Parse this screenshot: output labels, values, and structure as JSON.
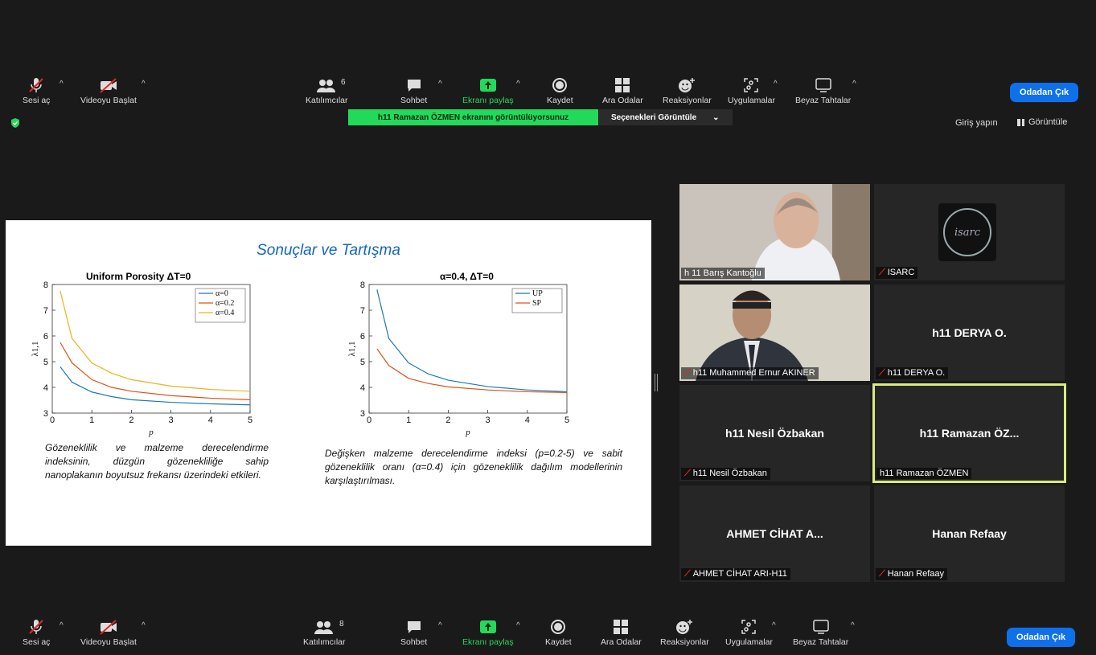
{
  "toolbar_top": {
    "mute": "Sesi aç",
    "video": "Videoyu Başlat",
    "participants": "Katılımcılar",
    "participants_count": "6",
    "chat": "Sohbet",
    "share": "Ekranı paylaş",
    "record": "Kaydet",
    "breakout": "Ara Odalar",
    "reactions": "Reaksiyonlar",
    "apps": "Uygulamalar",
    "whiteboard": "Beyaz Tahtalar",
    "leave": "Odadan Çık"
  },
  "toolbar_bottom": {
    "mute": "Sesi aç",
    "video": "Videoyu Başlat",
    "participants": "Katılımcılar",
    "participants_count": "8",
    "chat": "Sohbet",
    "share": "Ekranı paylaş",
    "record": "Kaydet",
    "breakout": "Ara Odalar",
    "reactions": "Reaksiyonlar",
    "apps": "Uygulamalar",
    "whiteboard": "Beyaz Tahtalar",
    "leave": "Odadan Çık"
  },
  "share_banner": "h11 Ramazan ÖZMEN ekranını görüntülüyorsunuz",
  "view_options": "Seçenekleri Görüntüle",
  "top_right": {
    "signin": "Giriş yapın",
    "view": "Görüntüle"
  },
  "slide": {
    "title": "Sonuçlar ve Tartışma",
    "caption_left": "Gözeneklilik ve malzeme derecelendirme indeksinin, düzgün gözenekliliğe sahip nanoplakanın boyutsuz frekansı üzerindeki etkileri.",
    "caption_right": "Değişken malzeme derecelendirme indeksi (p=0.2-5) ve sabit gözeneklilik oranı (α=0.4) için gözeneklilik dağılım modellerinin karşılaştırılması."
  },
  "colors": {
    "blue": "#1f77b4",
    "red": "#d95319",
    "yellow": "#edb120",
    "share_green": "#23d95b",
    "leave_blue": "#0e71eb"
  },
  "chart_data": [
    {
      "type": "line",
      "title": "Uniform Porosity  ΔT=0",
      "xlabel": "p",
      "ylabel": "λ1,1",
      "xlim": [
        0,
        5
      ],
      "ylim": [
        3,
        8
      ],
      "xticks": [
        "0",
        "1",
        "2",
        "3",
        "4",
        "5"
      ],
      "yticks": [
        "3",
        "4",
        "5",
        "6",
        "7",
        "8"
      ],
      "legend_position": "top-right",
      "series": [
        {
          "name": "α=0",
          "color": "#1f77b4",
          "x": [
            0.2,
            0.5,
            1,
            1.5,
            2,
            3,
            4,
            5
          ],
          "y": [
            4.8,
            4.2,
            3.82,
            3.64,
            3.52,
            3.42,
            3.36,
            3.32
          ]
        },
        {
          "name": "α=0.2",
          "color": "#d95319",
          "x": [
            0.2,
            0.5,
            1,
            1.5,
            2,
            3,
            4,
            5
          ],
          "y": [
            5.75,
            4.95,
            4.3,
            4.0,
            3.85,
            3.68,
            3.58,
            3.52
          ]
        },
        {
          "name": "α=0.4",
          "color": "#edb120",
          "x": [
            0.2,
            0.5,
            1,
            1.5,
            2,
            3,
            4,
            5
          ],
          "y": [
            7.75,
            5.9,
            4.95,
            4.55,
            4.3,
            4.05,
            3.92,
            3.85
          ]
        }
      ]
    },
    {
      "type": "line",
      "title": "α=0.4,  ΔT=0",
      "xlabel": "p",
      "ylabel": "λ1,1",
      "xlim": [
        0,
        5
      ],
      "ylim": [
        3,
        8
      ],
      "xticks": [
        "0",
        "1",
        "2",
        "3",
        "4",
        "5"
      ],
      "yticks": [
        "3",
        "4",
        "5",
        "6",
        "7",
        "8"
      ],
      "legend_position": "top-right",
      "series": [
        {
          "name": "UP",
          "color": "#1f77b4",
          "x": [
            0.2,
            0.5,
            1,
            1.5,
            2,
            3,
            4,
            5
          ],
          "y": [
            7.8,
            5.9,
            4.95,
            4.52,
            4.28,
            4.03,
            3.9,
            3.83
          ]
        },
        {
          "name": "SP",
          "color": "#d95319",
          "x": [
            0.2,
            0.5,
            1,
            1.5,
            2,
            3,
            4,
            5
          ],
          "y": [
            5.5,
            4.85,
            4.35,
            4.15,
            4.02,
            3.9,
            3.83,
            3.8
          ]
        }
      ]
    }
  ],
  "participants": [
    {
      "name": "h 11 Barış Kantoğlu",
      "muted": false,
      "video": true
    },
    {
      "name": "ISARC",
      "muted": true,
      "video": true
    },
    {
      "name": "h11 Muhammed Ernur AKINER",
      "muted": true,
      "video": true
    },
    {
      "name": "h11 DERYA O.",
      "display": "h11 DERYA O.",
      "muted": true,
      "video": false
    },
    {
      "name": "h11 Nesil Özbakan",
      "display": "h11 Nesil Özbakan",
      "muted": true,
      "video": false
    },
    {
      "name": "h11 Ramazan ÖZMEN",
      "display": "h11 Ramazan ÖZ...",
      "muted": false,
      "video": false,
      "active_speaker": true
    },
    {
      "name": "AHMET CİHAT ARI-H11",
      "display": "AHMET CİHAT A...",
      "muted": true,
      "video": false
    },
    {
      "name": "Hanan Refaay",
      "display": "Hanan Refaay",
      "muted": true,
      "video": false
    }
  ],
  "isarc_logo_text": "isarc"
}
